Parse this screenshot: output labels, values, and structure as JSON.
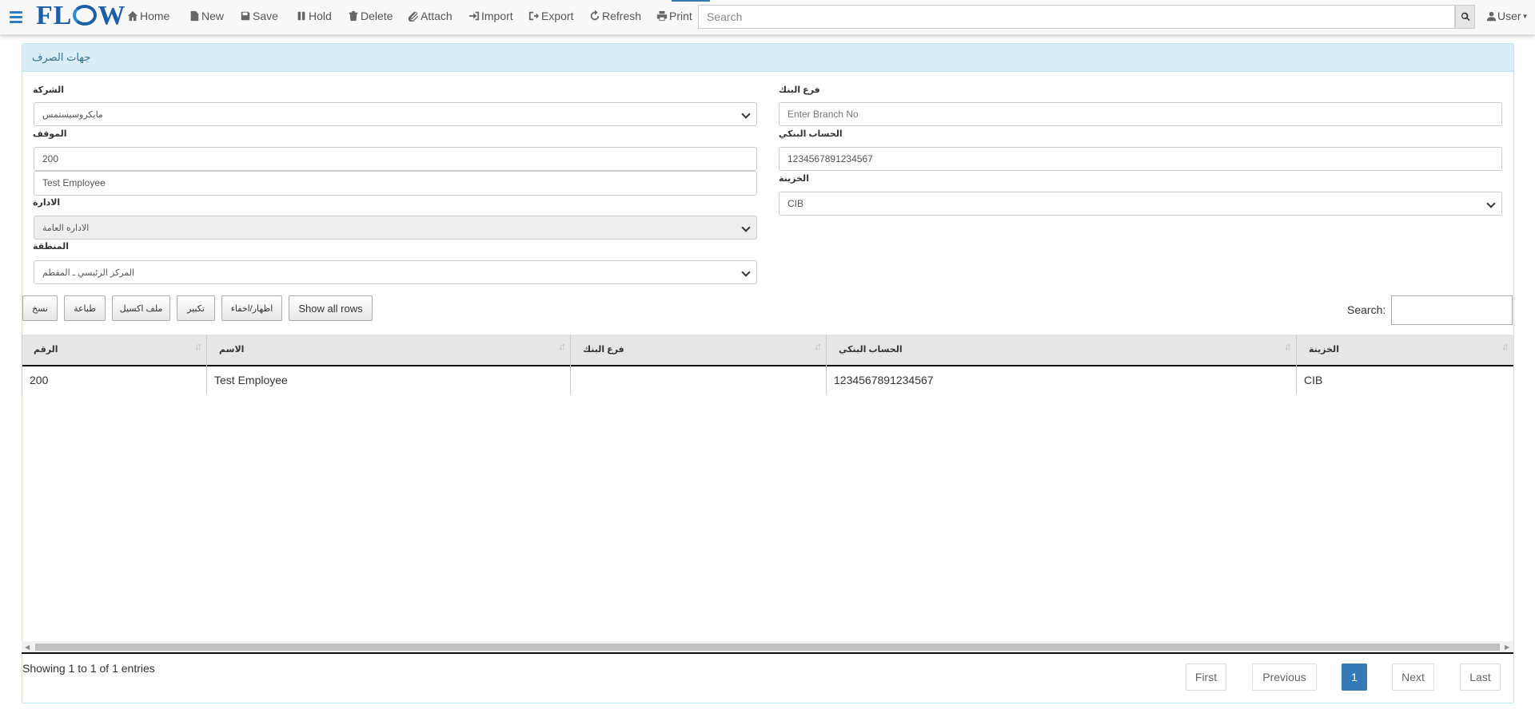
{
  "navbar": {
    "menu_icon": "hamburger-icon",
    "logo": "FLOW",
    "items": [
      {
        "label": "Home",
        "icon": "home-icon"
      },
      {
        "label": "New",
        "icon": "file-icon"
      },
      {
        "label": "Save",
        "icon": "floppy-icon"
      },
      {
        "label": "Hold",
        "icon": "pause-icon"
      },
      {
        "label": "Delete",
        "icon": "trash-icon"
      },
      {
        "label": "Attach",
        "icon": "paperclip-icon"
      },
      {
        "label": "Import",
        "icon": "import-icon"
      },
      {
        "label": "Export",
        "icon": "export-icon"
      },
      {
        "label": "Refresh",
        "icon": "refresh-icon"
      },
      {
        "label": "Print",
        "icon": "print-icon"
      }
    ],
    "search_placeholder": "Search",
    "user_label": "User"
  },
  "panel": {
    "title": "جهات الصرف"
  },
  "form": {
    "company_label": "الشركة",
    "company_value": "مايكروسيستمس",
    "position_label": "الموقف",
    "position_value": "200",
    "employee_value": "Test Employee",
    "department_label": "الادارة",
    "department_value": "الاداره العامة",
    "region_label": "المنطقة",
    "region_value": "المركز الرئيسي ـ المقطم",
    "bank_branch_label": "فرع البنك",
    "bank_branch_placeholder": "Enter Branch No",
    "bank_account_label": "الحساب البنكي",
    "bank_account_value": "1234567891234567",
    "treasury_label": "الخزينة",
    "treasury_value": "CIB"
  },
  "table_buttons": {
    "copy": "نسخ",
    "print": "طباعة",
    "excel": "ملف اكسيل",
    "enlarge": "تكبير",
    "toggle": "اظهار/اخفاء",
    "show_all": "Show all rows"
  },
  "table": {
    "search_label": "Search:",
    "columns": [
      "الرقم",
      "الاسم",
      "فرع البنك",
      "الحساب البنكي",
      "الخزينة"
    ],
    "rows": [
      [
        "200",
        "Test Employee",
        "",
        "1234567891234567",
        "CIB"
      ]
    ],
    "info": "Showing 1 to 1 of 1 entries"
  },
  "pagination": {
    "first": "First",
    "previous": "Previous",
    "current": "1",
    "next": "Next",
    "last": "Last"
  },
  "colors": {
    "accent": "#337ab7",
    "panel_heading_bg": "#d9edf7",
    "panel_heading_text": "#31708f"
  }
}
